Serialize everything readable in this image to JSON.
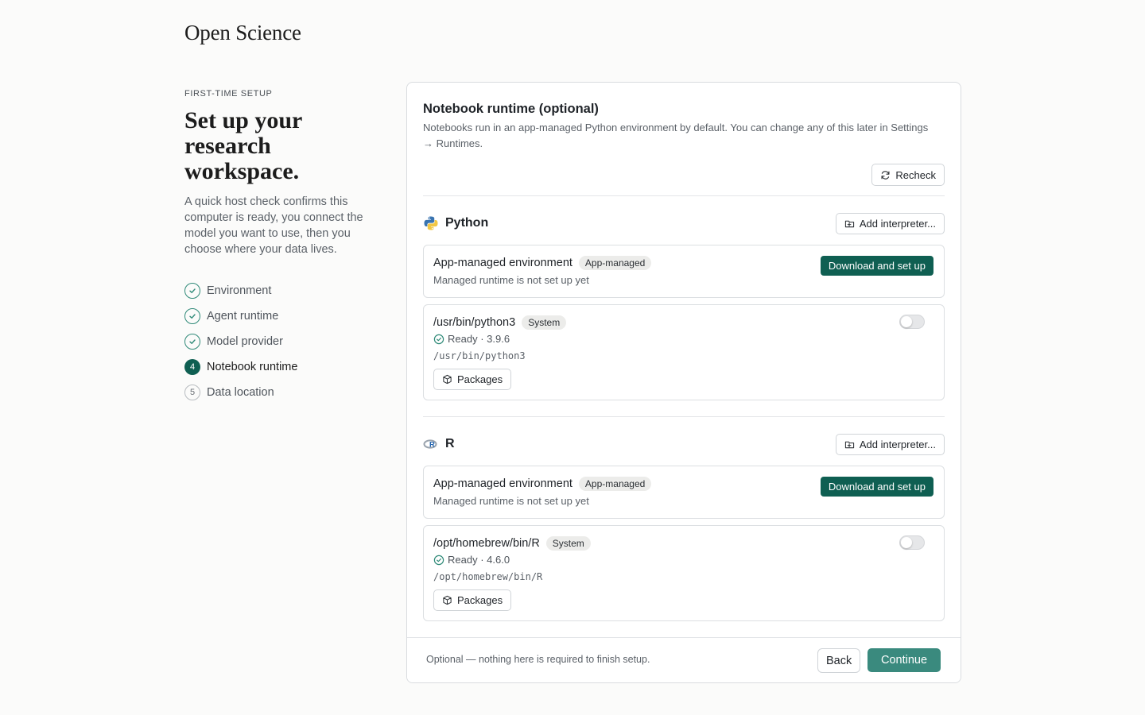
{
  "brand": "Open Science",
  "left": {
    "eyebrow": "FIRST-TIME SETUP",
    "headline_line1": "Set up your",
    "headline_line2": "research",
    "headline_line3": "workspace.",
    "lead": "A quick host check confirms this computer is ready, you connect the model you want to use, then you choose where your data lives.",
    "steps": [
      {
        "label": "Environment",
        "state": "done",
        "marker": ""
      },
      {
        "label": "Agent runtime",
        "state": "done",
        "marker": ""
      },
      {
        "label": "Model provider",
        "state": "done",
        "marker": ""
      },
      {
        "label": "Notebook runtime",
        "state": "active",
        "marker": "4"
      },
      {
        "label": "Data location",
        "state": "todo",
        "marker": "5"
      }
    ]
  },
  "card": {
    "title": "Notebook runtime (optional)",
    "description": "Notebooks run in an app-managed Python environment by default. You can change any of this later in Settings → Runtimes.",
    "recheck_label": "Recheck",
    "python": {
      "name": "Python",
      "add_label": "Add interpreter...",
      "managed": {
        "title": "App-managed environment",
        "badge": "App-managed",
        "subtitle": "Managed runtime is not set up yet",
        "action": "Download and set up"
      },
      "system": {
        "title": "/usr/bin/python3",
        "badge": "System",
        "status": "Ready · 3.9.6",
        "path": "/usr/bin/python3",
        "packages_label": "Packages",
        "enabled": false
      }
    },
    "r": {
      "name": "R",
      "add_label": "Add interpreter...",
      "managed": {
        "title": "App-managed environment",
        "badge": "App-managed",
        "subtitle": "Managed runtime is not set up yet",
        "action": "Download and set up"
      },
      "system": {
        "title": "/opt/homebrew/bin/R",
        "badge": "System",
        "status": "Ready · 4.6.0",
        "path": "/opt/homebrew/bin/R",
        "packages_label": "Packages",
        "enabled": false
      }
    },
    "footer": {
      "note": "Optional — nothing here is required to finish setup.",
      "back_label": "Back",
      "continue_label": "Continue"
    }
  },
  "colors": {
    "primary": "#0f5f52",
    "continue": "#3a8a7e",
    "check": "#2f8a78"
  }
}
